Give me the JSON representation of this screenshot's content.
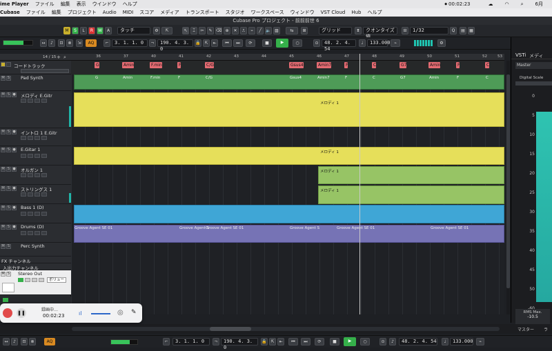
{
  "mac_menu_top": [
    "ime Player",
    "ファイル",
    "編集",
    "表示",
    "ウインドウ",
    "ヘルプ"
  ],
  "mac_menu_cubase": [
    "Cubase",
    "ファイル",
    "編集",
    "プロジェクト",
    "Audio",
    "MIDI",
    "スコア",
    "メディア",
    "トランスポート",
    "スタジオ",
    "ワークスペース",
    "ウィンドウ",
    "VST Cloud",
    "Hub",
    "ヘルプ"
  ],
  "mac_status": {
    "record_time": "00:02:23",
    "date": "6月"
  },
  "window_title": "Cubase Pro プロジェクト - 前前前世 6",
  "toolbar": {
    "mode_buttons": [
      "M",
      "S",
      "L",
      "R",
      "W",
      "A"
    ],
    "automation_mode": "タッチ",
    "snap_type": "グリッド",
    "quantize_type": "クオンタイズ値",
    "quantize_value": "1/32"
  },
  "transport": {
    "aq": "AQ",
    "left_locator": "3. 1. 1.  0",
    "right_locator": "190. 4. 3.  0",
    "position": "48. 2. 4. 54",
    "tempo": "133.000"
  },
  "tracklist": {
    "counter": "14 / 15",
    "tracks": [
      {
        "name": "コードトラック",
        "color": "#d8a030"
      },
      {
        "name": "Pad Synth",
        "color": "#5b9a4c"
      },
      {
        "name": "メロディ  E.Gitr",
        "color": "#21b5a8"
      },
      {
        "name": "イントロ 1 E.Gitr",
        "color": "#21b5a8"
      },
      {
        "name": "E.Gitar  1",
        "color": "#21b5a8"
      },
      {
        "name": "オルガン 1",
        "color": "#21b5a8"
      },
      {
        "name": "ストリングス 1",
        "color": "#21b5a8"
      },
      {
        "name": "Bass  1 (D)",
        "color": "#21b5a8"
      },
      {
        "name": "Drums (D)",
        "color": "#21b5a8"
      },
      {
        "name": "Perc Synth",
        "color": "#21b5a8"
      },
      {
        "name": "FX チャンネル",
        "color": "#777777"
      },
      {
        "name": "入出力チャンネル",
        "color": "#777777"
      },
      {
        "name": "Stereo Out",
        "color": "#777777"
      }
    ],
    "stereo_out_insert": "ボリュー"
  },
  "ruler_ticks": [
    "36",
    "37",
    "40",
    "41",
    "42",
    "43",
    "44",
    "45",
    "46",
    "47",
    "48",
    "49",
    "50",
    "51",
    "52",
    "53"
  ],
  "chords": [
    "G",
    "Amin",
    "F.min",
    "F",
    "C/G",
    "Gsus4",
    "Amin7",
    "F",
    "C",
    "G7",
    "Amin",
    "F",
    "C"
  ],
  "pad_chords": [
    "G",
    "Amin",
    "F.min",
    "F",
    "C/G",
    "Gsus4",
    "Amin7",
    "F",
    "C",
    "G7",
    "Amin",
    "F",
    "C"
  ],
  "part_labels": {
    "melody": "メロディ 1",
    "drums": [
      "Groove Agent SE 01",
      "Groove Agent S",
      "Groove Agent SE 01",
      "Groove Agent S",
      "Groove Agent SE 01",
      "Groove Agent SE 01"
    ]
  },
  "right_panel": {
    "tabs": [
      "VSTi",
      "メディ"
    ],
    "master": "Master",
    "meter_label": "Digital Scale",
    "scale": [
      "0",
      "5",
      "10",
      "15",
      "20",
      "25",
      "30",
      "35",
      "40",
      "45",
      "50",
      "-60"
    ],
    "rms_label": "RMS Max.",
    "rms_value": "-10.5",
    "bottom_tab": "マスター",
    "bottom_tab2": "ラ"
  },
  "recording": {
    "status": "録画中…",
    "time": "00:02:23"
  },
  "colors": {
    "yellow": "#e6df5a",
    "green": "#7ab64f",
    "blue": "#3fa6d6",
    "purple": "#7673b5",
    "pad": "#4e9b57",
    "chord": "#e46b72"
  }
}
